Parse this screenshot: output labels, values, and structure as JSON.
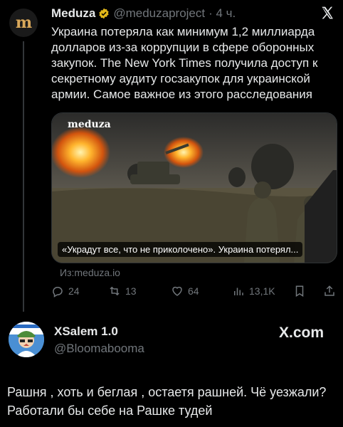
{
  "quoted_tweet": {
    "avatar_letter": "m",
    "name": "Meduza",
    "handle": "@meduzaproject",
    "time": "· 4 ч.",
    "text": "Украина потеряла как минимум 1,2 миллиарда долларов из-за коррупции в сфере оборонных закупок. The New York Times получила доступ к секретному аудиту госзакупок для украинской армии. Самое важное из этого расследования",
    "card": {
      "logo": "meduza",
      "caption": "«Украдут все, что не приколочено». Украина потерял..."
    },
    "source": "Из:meduza.io",
    "actions": {
      "replies": "24",
      "reposts": "13",
      "likes": "64",
      "views": "13,1K"
    }
  },
  "main_tweet": {
    "name": "XSalem 1.0",
    "handle": "@Bloomabooma",
    "platform": "X.com",
    "text": "Рашня , хоть и беглая , остаетя  рашней. Чё уезжали? Работали бы себе на Рашке тудей"
  },
  "colors": {
    "background": "#000000",
    "text": "#e7e9ea",
    "muted": "#71767b",
    "verified": "#e2b719"
  }
}
